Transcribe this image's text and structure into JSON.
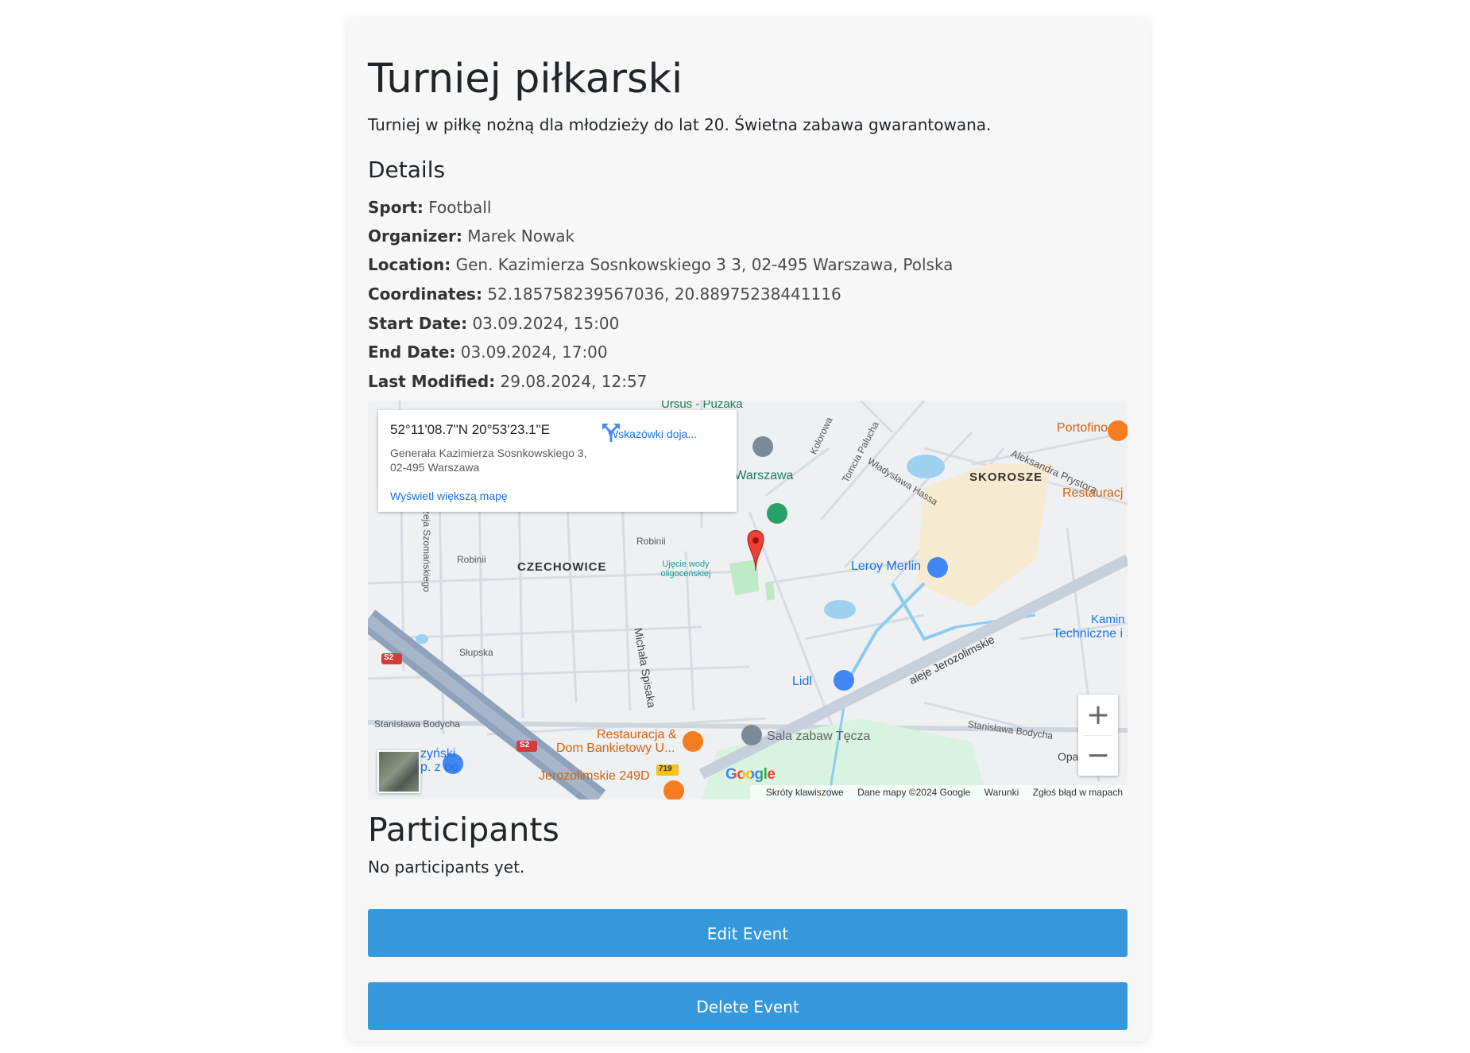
{
  "event": {
    "title": "Turniej piłkarski",
    "description": "Turniej w piłkę nożną dla młodzieży do lat 20. Świetna zabawa gwarantowana."
  },
  "details": {
    "heading": "Details",
    "sport_label": "Sport:",
    "sport": "Football",
    "organizer_label": "Organizer:",
    "organizer": "Marek Nowak",
    "location_label": "Location:",
    "location": "Gen. Kazimierza Sosnkowskiego 3 3, 02-495 Warszawa, Polska",
    "coordinates_label": "Coordinates:",
    "coordinates": "52.185758239567036, 20.88975238441116",
    "start_label": "Start Date:",
    "start": "03.09.2024, 15:00",
    "end_label": "End Date:",
    "end": "03.09.2024, 17:00",
    "modified_label": "Last Modified:",
    "modified": "29.08.2024, 12:57"
  },
  "map": {
    "infobox": {
      "coords": "52°11'08.7\"N 20°53'23.1\"E",
      "address": "Generała Kazimierza Sosnkowskiego 3, 02-495 Warszawa",
      "directions": "Wskazówki doja...",
      "larger_map": "Wyświetl większą mapę"
    },
    "labels": {
      "ursus": "Ursus - Puzaka",
      "portofino": "Portofino",
      "aleksandra": "Aleksandra Prystora",
      "skorosze": "SKOROSZE",
      "restauracj": "Restauracj",
      "warszawa": "o Warszawa",
      "kolorowa": "Kolorowa",
      "palucha": "Tomcia Palucha",
      "hassa": "Władysława Hassa",
      "robinii1": "Robinii",
      "robinii2": "Robinii",
      "czechowice": "CZECHOWICE",
      "ujecie": "Ujęcie wody oligoceńskiej",
      "leroy": "Leroy Merlin",
      "kamin": "Kamin",
      "techniczne": "Techniczne i Spo",
      "jerozolimskie": "aleje Jerozolimskie",
      "szomanskiego": "zeja Szomańskiego",
      "slupska": "Słupska",
      "spisaka": "Michała Spisaka",
      "lidl": "Lidl",
      "bodycha1": "Stanisława Bodycha",
      "bodycha2": "Stanisława Bodycha",
      "restauracja": "Restauracja &",
      "bankietowy": "Dom Bankietowy U...",
      "sala": "Sala zabaw Tęcza",
      "zynski": "zyński",
      "zoo": "p. z oo",
      "jerozolimskie249": "Jerozolimskie 249D",
      "opa": "Opa",
      "s2a": "S2",
      "s2b": "S2",
      "r719": "719"
    },
    "google": "Google",
    "zoom_in": "+",
    "zoom_out": "−",
    "attrib": {
      "shortcuts": "Skróty klawiszowe",
      "data": "Dane mapy ©2024 Google",
      "terms": "Warunki",
      "report": "Zgłoś błąd w mapach"
    }
  },
  "participants": {
    "heading": "Participants",
    "empty": "No participants yet."
  },
  "buttons": {
    "edit": "Edit Event",
    "delete": "Delete Event"
  },
  "colors": {
    "button": "#3498db",
    "card_bg": "#f7f7f7",
    "marker": "#ea4335",
    "link": "#1a73e8"
  }
}
